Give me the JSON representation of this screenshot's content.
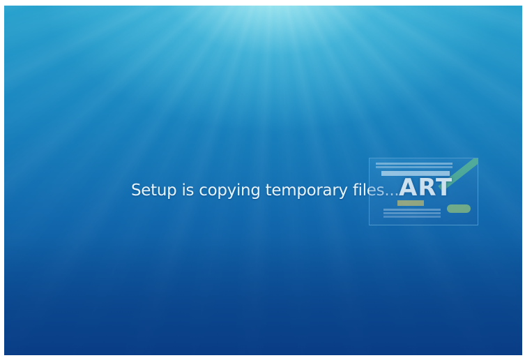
{
  "screen": {
    "status_text": "Setup is copying temporary files...",
    "background_colors": {
      "glow": "#b9f5f8",
      "top": "#2aa3cf",
      "bottom": "#0a4590"
    }
  },
  "watermark": {
    "logo_text": "ART",
    "logo_color": "#ffffff"
  }
}
